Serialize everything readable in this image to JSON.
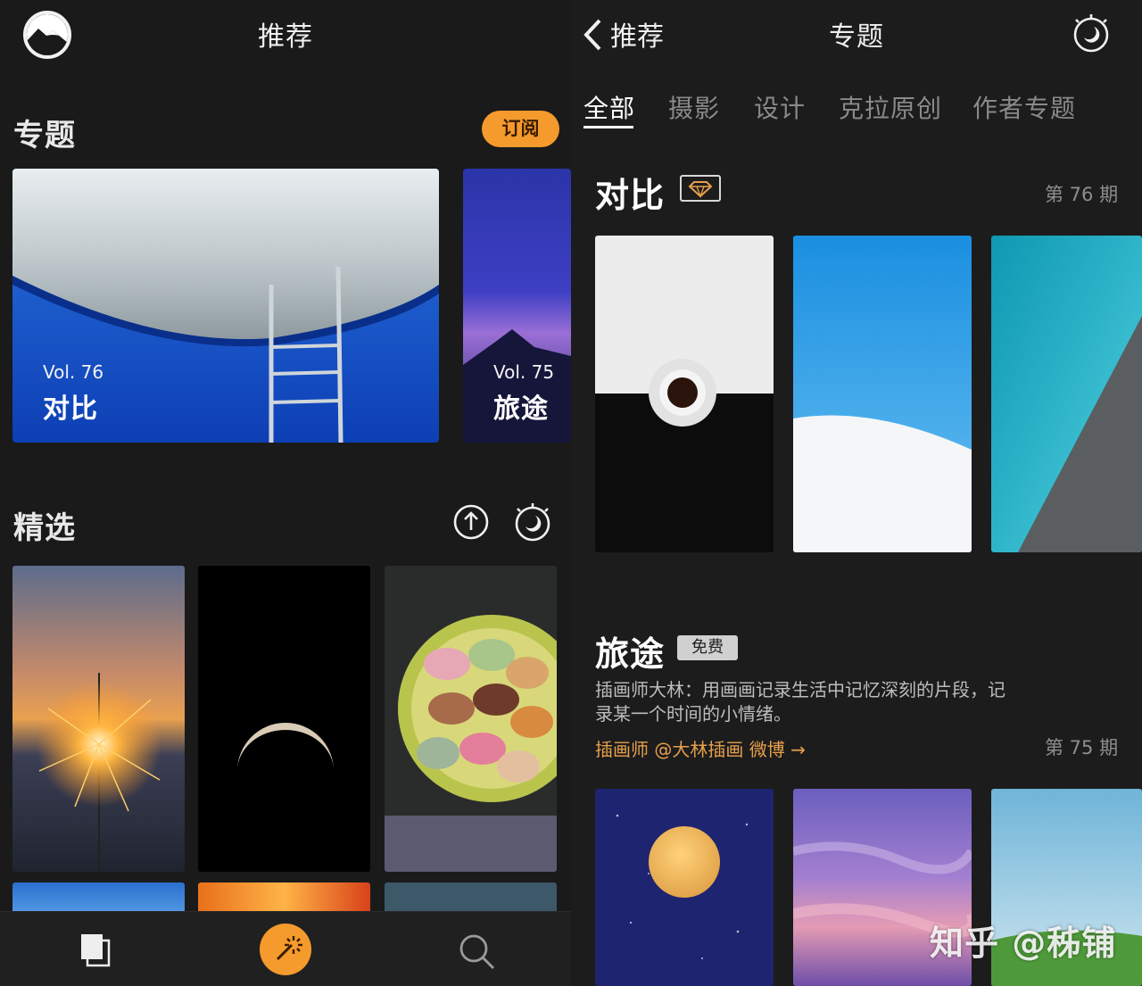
{
  "left": {
    "header": {
      "title": "推荐",
      "logo_icon": "mountain-logo-icon"
    },
    "topics_section": {
      "title": "专题",
      "subscribe_label": "订阅",
      "cards": [
        {
          "vol": "Vol. 76",
          "name": "对比"
        },
        {
          "vol": "Vol. 75",
          "name": "旅途"
        }
      ]
    },
    "featured_section": {
      "title": "精选",
      "upload_icon": "upload-icon",
      "night_icon": "night-timer-icon"
    },
    "tabbar": {
      "items": [
        {
          "icon": "gallery-icon"
        },
        {
          "icon": "magic-wand-icon",
          "active": true
        },
        {
          "icon": "search-icon"
        }
      ],
      "accent": "#f59a2c"
    }
  },
  "right": {
    "header": {
      "back_label": "推荐",
      "title": "专题",
      "night_icon": "night-timer-icon"
    },
    "tabs": [
      {
        "label": "全部",
        "active": true
      },
      {
        "label": "摄影"
      },
      {
        "label": "设计"
      },
      {
        "label": "克拉原创"
      },
      {
        "label": "作者专题"
      }
    ],
    "topic1": {
      "title": "对比",
      "badge_icon": "diamond-icon",
      "issue": "第 76 期"
    },
    "topic2": {
      "title": "旅途",
      "badge": "免费",
      "description": "插画师大林：用画画记录生活中记忆深刻的片段，记录某一个时间的小情绪。",
      "author_link": "插画师 @大林插画 微博 →",
      "issue": "第 75 期"
    },
    "watermark": "知乎 @秭铺"
  }
}
